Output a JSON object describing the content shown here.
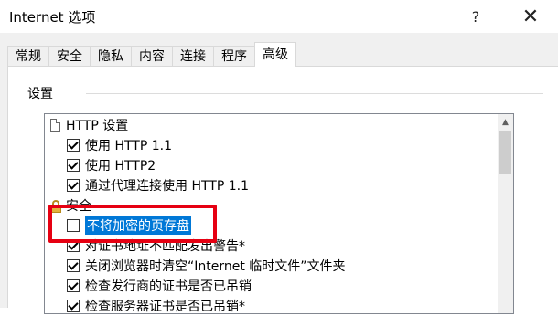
{
  "window": {
    "title": "Internet 选项",
    "help_glyph": "?",
    "close_glyph": "✕"
  },
  "tabs": [
    {
      "label": "常规"
    },
    {
      "label": "安全"
    },
    {
      "label": "隐私"
    },
    {
      "label": "内容"
    },
    {
      "label": "连接"
    },
    {
      "label": "程序"
    },
    {
      "label": "高级",
      "active": true
    }
  ],
  "settings": {
    "group_label": "设置",
    "items": [
      {
        "type": "header",
        "icon": "document-icon",
        "label": "HTTP 设置"
      },
      {
        "type": "checkbox",
        "checked": true,
        "label": "使用 HTTP 1.1"
      },
      {
        "type": "checkbox",
        "checked": true,
        "label": "使用 HTTP2"
      },
      {
        "type": "checkbox",
        "checked": true,
        "label": "通过代理连接使用 HTTP 1.1"
      },
      {
        "type": "header",
        "icon": "lock-icon",
        "label": "安全"
      },
      {
        "type": "checkbox",
        "checked": false,
        "selected": true,
        "label": "不将加密的页存盘"
      },
      {
        "type": "checkbox",
        "checked": true,
        "label": "对证书地址不匹配发出警告*"
      },
      {
        "type": "checkbox",
        "checked": true,
        "label": "关闭浏览器时清空“Internet 临时文件”文件夹"
      },
      {
        "type": "checkbox",
        "checked": true,
        "label": "检查发行商的证书是否已吊销"
      },
      {
        "type": "checkbox",
        "checked": true,
        "label": "检查服务器证书是否已吊销*"
      }
    ]
  },
  "colors": {
    "selection": "#0078d7",
    "highlight_border": "#e60012"
  }
}
